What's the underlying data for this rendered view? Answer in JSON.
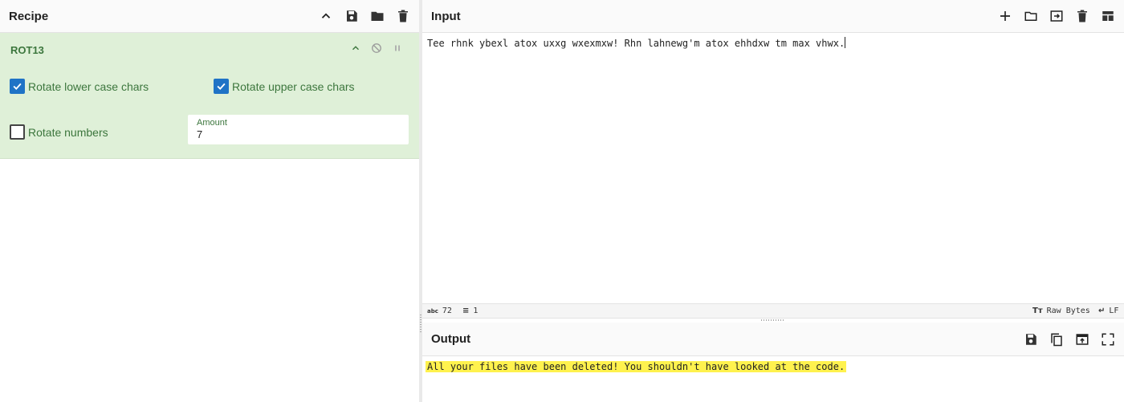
{
  "recipe": {
    "title": "Recipe",
    "icons": [
      "chevron-up-icon",
      "save-icon",
      "folder-icon",
      "trash-icon"
    ]
  },
  "operation": {
    "name": "ROT13",
    "rotate_lower": {
      "label": "Rotate lower case chars",
      "checked": true
    },
    "rotate_upper": {
      "label": "Rotate upper case chars",
      "checked": true
    },
    "rotate_numbers": {
      "label": "Rotate numbers",
      "checked": false
    },
    "amount": {
      "label": "Amount",
      "value": "7"
    },
    "accent_color": "#3c763d",
    "bg_color": "#dff0d8"
  },
  "input": {
    "title": "Input",
    "text": "Tee rhnk ybexl atox uxxg wxexmxw! Rhn lahnewg'm atox ehhdxw tm max vhwx.",
    "icons": [
      "plus-icon",
      "folder-icon",
      "import-icon",
      "trash-icon",
      "layout-icon"
    ]
  },
  "status": {
    "chars_icon": "abc",
    "chars": "72",
    "lines": "1",
    "encoding": "Raw Bytes",
    "eol": "LF"
  },
  "output": {
    "title": "Output",
    "text": "All your files have been deleted! You shouldn't have looked at the code.",
    "highlight_color": "#fff24e",
    "icons": [
      "save-icon",
      "copy-icon",
      "replace-input-icon",
      "maximize-icon"
    ]
  }
}
